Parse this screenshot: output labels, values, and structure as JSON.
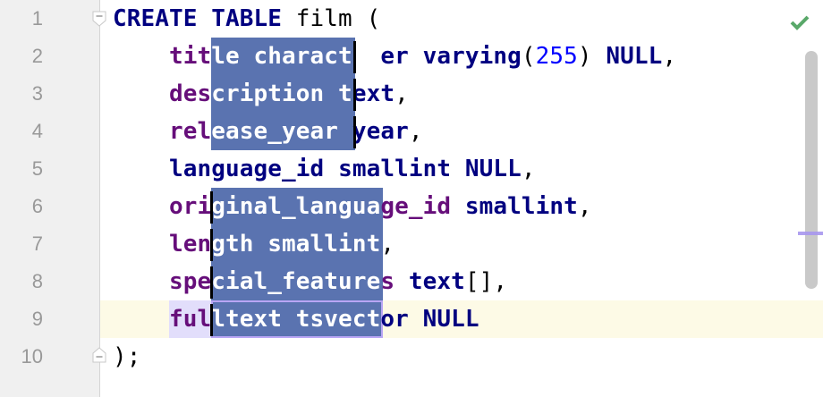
{
  "editor": {
    "status_icon": "inspection-ok-check-icon",
    "colors": {
      "keyword": "#000080",
      "column": "#660e7a",
      "number": "#0000ff",
      "selection": "#5a73b0",
      "current_line": "#fdfae6"
    },
    "current_line": 9,
    "lines": [
      {
        "n": "1",
        "tokens": [
          {
            "t": "CREATE TABLE",
            "c": "kw"
          },
          {
            "t": " film (",
            "c": "plain"
          }
        ]
      },
      {
        "n": "2",
        "tokens": [
          {
            "t": "    ",
            "c": "plain"
          },
          {
            "t": "tit",
            "c": "col"
          },
          {
            "t": "le character",
            "c": "col",
            "sel": true
          },
          {
            "t": "er varying",
            "c": "kw"
          },
          {
            "t": "(",
            "c": "plain"
          },
          {
            "t": "255",
            "c": "num"
          },
          {
            "t": ") ",
            "c": "plain"
          },
          {
            "t": "NULL",
            "c": "kw"
          },
          {
            "t": ",",
            "c": "plain"
          }
        ]
      },
      {
        "n": "3",
        "tokens": [
          {
            "t": "    ",
            "c": "plain"
          },
          {
            "t": "des",
            "c": "col"
          },
          {
            "t": "cription t",
            "c": "col",
            "sel": true
          },
          {
            "t": "ext",
            "c": "kw"
          },
          {
            "t": ",",
            "c": "plain"
          }
        ]
      },
      {
        "n": "4",
        "tokens": [
          {
            "t": "    ",
            "c": "plain"
          },
          {
            "t": "rel",
            "c": "col"
          },
          {
            "t": "ease_year ",
            "c": "col",
            "sel": true
          },
          {
            "t": "year",
            "c": "kw"
          },
          {
            "t": ",",
            "c": "plain"
          }
        ]
      },
      {
        "n": "5",
        "tokens": [
          {
            "t": "    ",
            "c": "plain"
          },
          {
            "t": "language_id",
            "c": "kw"
          },
          {
            "t": " ",
            "c": "plain"
          },
          {
            "t": "smallint NULL",
            "c": "kw"
          },
          {
            "t": ",",
            "c": "plain"
          }
        ]
      },
      {
        "n": "6",
        "tokens": [
          {
            "t": "    ",
            "c": "plain"
          },
          {
            "t": "ori",
            "c": "col"
          },
          {
            "t": "ginal_langua",
            "c": "col",
            "sel": true
          },
          {
            "t": "ge_id",
            "c": "col"
          },
          {
            "t": " ",
            "c": "plain"
          },
          {
            "t": "smallint",
            "c": "kw"
          },
          {
            "t": ",",
            "c": "plain"
          }
        ]
      },
      {
        "n": "7",
        "tokens": [
          {
            "t": "    ",
            "c": "plain"
          },
          {
            "t": "len",
            "c": "col"
          },
          {
            "t": "gth smallint",
            "c": "col",
            "sel": true
          },
          {
            "t": ",",
            "c": "plain"
          }
        ]
      },
      {
        "n": "8",
        "tokens": [
          {
            "t": "    ",
            "c": "plain"
          },
          {
            "t": "spe",
            "c": "col"
          },
          {
            "t": "cial_feature",
            "c": "col",
            "sel": true
          },
          {
            "t": "s",
            "c": "col"
          },
          {
            "t": " ",
            "c": "plain"
          },
          {
            "t": "text",
            "c": "kw"
          },
          {
            "t": "[],",
            "c": "plain"
          }
        ]
      },
      {
        "n": "9",
        "tokens": [
          {
            "t": "    ",
            "c": "plain"
          },
          {
            "t": "ful",
            "c": "col"
          },
          {
            "t": "ltext tsvect",
            "c": "col",
            "sel": true
          },
          {
            "t": "or NULL",
            "c": "kw"
          }
        ]
      },
      {
        "n": "10",
        "tokens": [
          {
            "t": ");",
            "c": "plain"
          }
        ]
      }
    ]
  }
}
